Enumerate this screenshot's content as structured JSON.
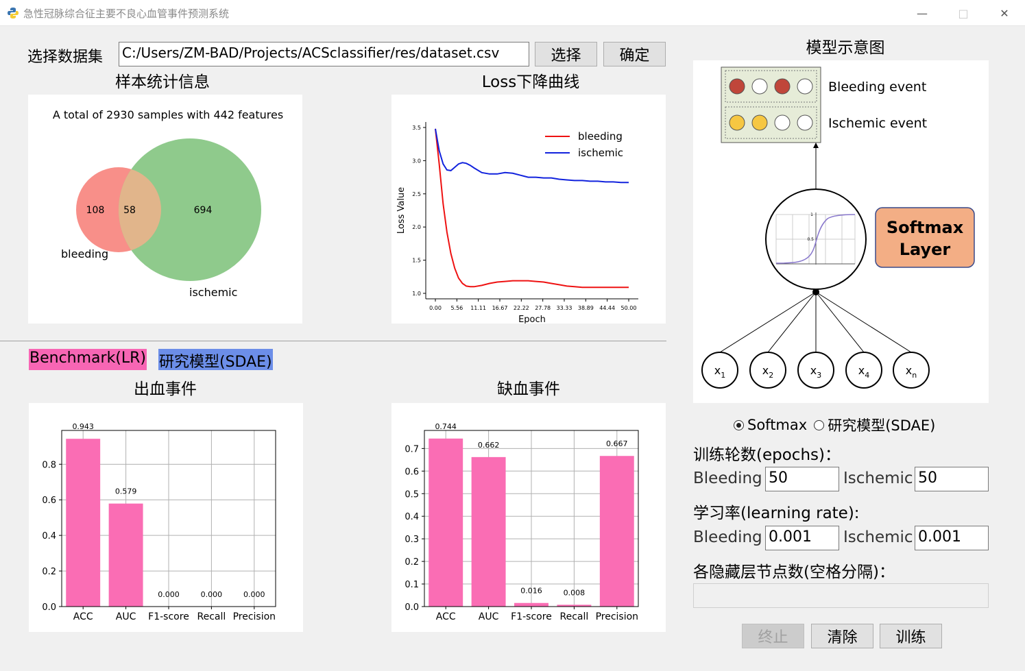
{
  "window": {
    "title": "急性冠脉综合征主要不良心血管事件预测系统"
  },
  "dataset": {
    "label": "选择数据集",
    "path": "C:/Users/ZM-BAD/Projects/ACSclassifier/res/dataset.csv",
    "select_label": "选择",
    "confirm_label": "确定"
  },
  "sections": {
    "stats_title": "样本统计信息",
    "loss_title": "Loss下降曲线",
    "bleed_title": "出血事件",
    "isch_title": "缺血事件",
    "model_title": "模型示意图"
  },
  "legend_tags": {
    "benchmark": "Benchmark(LR)",
    "sdae": "研究模型(SDAE)"
  },
  "venn": {
    "summary": "A total of 2930 samples with 442 features",
    "left_only": "108",
    "overlap": "58",
    "right_only": "694",
    "left_label": "bleeding",
    "right_label": "ischemic",
    "left_color": "#f88f89",
    "right_color": "#8fca8c",
    "overlap_color": "#e1b58b"
  },
  "model_diagram": {
    "output_labels": [
      "Bleeding event",
      "Ischemic event"
    ],
    "layer_label": [
      "Softmax",
      "Layer"
    ],
    "inputs": [
      "x",
      "x",
      "x",
      "x",
      "x"
    ],
    "input_subs": [
      "1",
      "2",
      "3",
      "4",
      "n"
    ],
    "sigmoid_ticks": [
      "1",
      "0.5"
    ]
  },
  "controls": {
    "radio_softmax": "Softmax",
    "radio_sdae": "研究模型(SDAE)",
    "epochs_label": "训练轮数(epochs)：",
    "lr_label": "学习率(learning  rate):",
    "hidden_label": "各隐藏层节点数(空格分隔)：",
    "bleeding_label": "Bleeding",
    "ischemic_label": "Ischemic",
    "epochs_bleeding": "50",
    "epochs_ischemic": "50",
    "lr_bleeding": "0.001",
    "lr_ischemic": "0.001",
    "hidden_value": "",
    "stop_label": "终止",
    "clear_label": "清除",
    "train_label": "训练"
  },
  "chart_data": [
    {
      "type": "line",
      "xlabel": "Epoch",
      "ylabel": "Loss Value",
      "x_ticks": [
        "0.00",
        "5.56",
        "11.11",
        "16.67",
        "22.22",
        "27.78",
        "33.33",
        "38.89",
        "44.44",
        "50.00"
      ],
      "y_ticks": [
        "1.0",
        "1.5",
        "2.0",
        "2.5",
        "3.0",
        "3.5"
      ],
      "xlim": [
        0,
        50
      ],
      "ylim": [
        1.0,
        3.5
      ],
      "legend_position": "top-right",
      "x": [
        0,
        1,
        2,
        3,
        4,
        5,
        6,
        7,
        8,
        9,
        10,
        12,
        14,
        16,
        18,
        20,
        22,
        24,
        26,
        28,
        30,
        32,
        34,
        36,
        38,
        40,
        42,
        44,
        46,
        48,
        50
      ],
      "series": [
        {
          "name": "bleeding",
          "color": "#ee1111",
          "values": [
            3.48,
            2.95,
            2.35,
            1.92,
            1.6,
            1.38,
            1.23,
            1.15,
            1.11,
            1.1,
            1.1,
            1.12,
            1.15,
            1.17,
            1.18,
            1.19,
            1.19,
            1.19,
            1.18,
            1.17,
            1.15,
            1.13,
            1.11,
            1.1,
            1.09,
            1.09,
            1.09,
            1.09,
            1.09,
            1.09,
            1.09
          ]
        },
        {
          "name": "ischemic",
          "color": "#1122dd",
          "values": [
            3.48,
            3.15,
            2.95,
            2.86,
            2.85,
            2.9,
            2.95,
            2.97,
            2.96,
            2.93,
            2.89,
            2.82,
            2.8,
            2.8,
            2.82,
            2.81,
            2.78,
            2.75,
            2.75,
            2.74,
            2.74,
            2.72,
            2.71,
            2.7,
            2.7,
            2.69,
            2.69,
            2.68,
            2.68,
            2.67,
            2.67
          ]
        }
      ]
    },
    {
      "type": "bar",
      "title": "出血事件",
      "categories": [
        "ACC",
        "AUC",
        "F1-score",
        "Recall",
        "Precision"
      ],
      "values": [
        0.943,
        0.579,
        0.0,
        0.0,
        0.0
      ],
      "labels": [
        "0.943",
        "0.579",
        "0.000",
        "0.000",
        "0.000"
      ],
      "y_ticks": [
        "0.0",
        "0.2",
        "0.4",
        "0.6",
        "0.8"
      ],
      "ylim": [
        0,
        0.99
      ],
      "color": "#fa6db4",
      "grid": true
    },
    {
      "type": "bar",
      "title": "缺血事件",
      "categories": [
        "ACC",
        "AUC",
        "F1-score",
        "Recall",
        "Precision"
      ],
      "values": [
        0.744,
        0.662,
        0.016,
        0.008,
        0.667
      ],
      "labels": [
        "0.744",
        "0.662",
        "0.016",
        "0.008",
        "0.667"
      ],
      "y_ticks": [
        "0.0",
        "0.1",
        "0.2",
        "0.3",
        "0.4",
        "0.5",
        "0.6",
        "0.7"
      ],
      "ylim": [
        0,
        0.78
      ],
      "color": "#fa6db4",
      "grid": true
    }
  ]
}
